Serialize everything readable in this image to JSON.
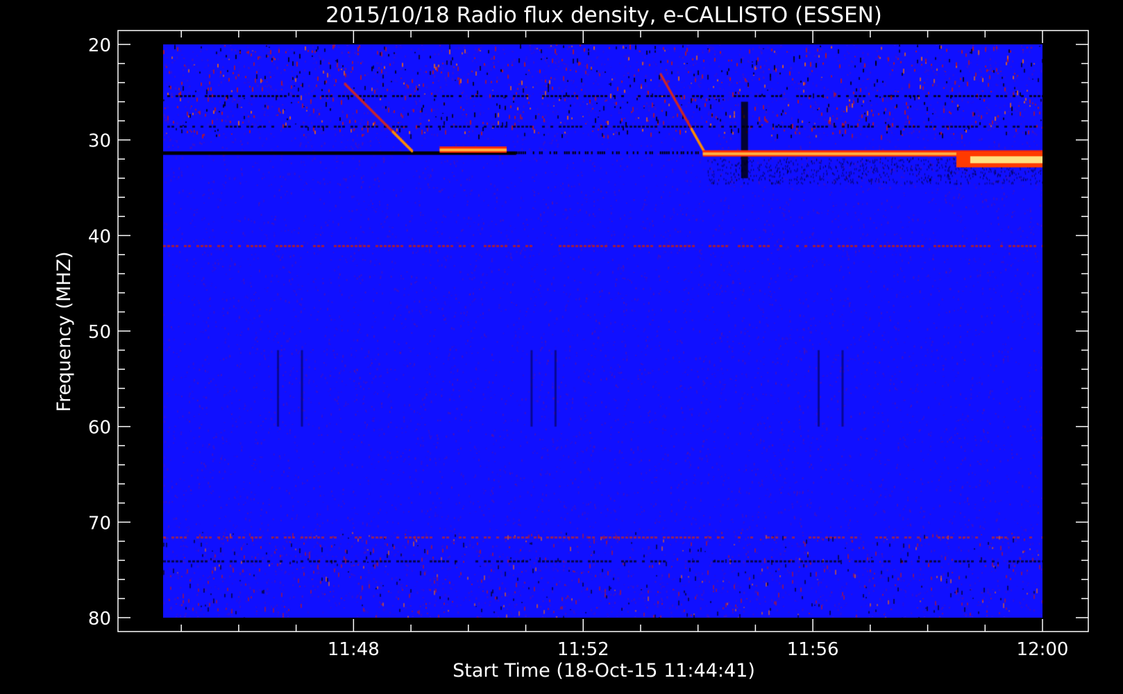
{
  "chart_data": {
    "type": "heatmap",
    "title": "2015/10/18  Radio flux density, e-CALLISTO (ESSEN)",
    "xlabel": "Start Time (18-Oct-15 11:44:41)",
    "ylabel": "Frequency (MHZ)",
    "x_unit": "UT time",
    "xlim": [
      "11:44:41",
      "12:00:00"
    ],
    "ylim": [
      80,
      20
    ],
    "y_ticks": [
      "20",
      "30",
      "40",
      "50",
      "60",
      "70",
      "80"
    ],
    "x_ticks": [
      "11:48",
      "11:52",
      "11:56",
      "12:00"
    ],
    "colormap": [
      "#000000",
      "#1010ff",
      "#c01010",
      "#ff6000",
      "#ffff80"
    ],
    "features": [
      {
        "kind": "drift-burst",
        "t_start": "11:47:50",
        "t_end": "11:49:00",
        "f_start": 24,
        "f_end": 31
      },
      {
        "kind": "drift-burst",
        "t_start": "11:53:20",
        "t_end": "11:54:05",
        "f_start": 23,
        "f_end": 31
      },
      {
        "kind": "narrowband-emission",
        "t_start": "11:49:30",
        "t_end": "11:50:40",
        "f": 30.9
      },
      {
        "kind": "narrowband-emission",
        "t_start": "11:54:05",
        "t_end": "12:00:00",
        "f": 31.3
      },
      {
        "kind": "intense-emission",
        "t_start": "11:58:30",
        "t_end": "12:00:00",
        "f": 32
      }
    ]
  }
}
